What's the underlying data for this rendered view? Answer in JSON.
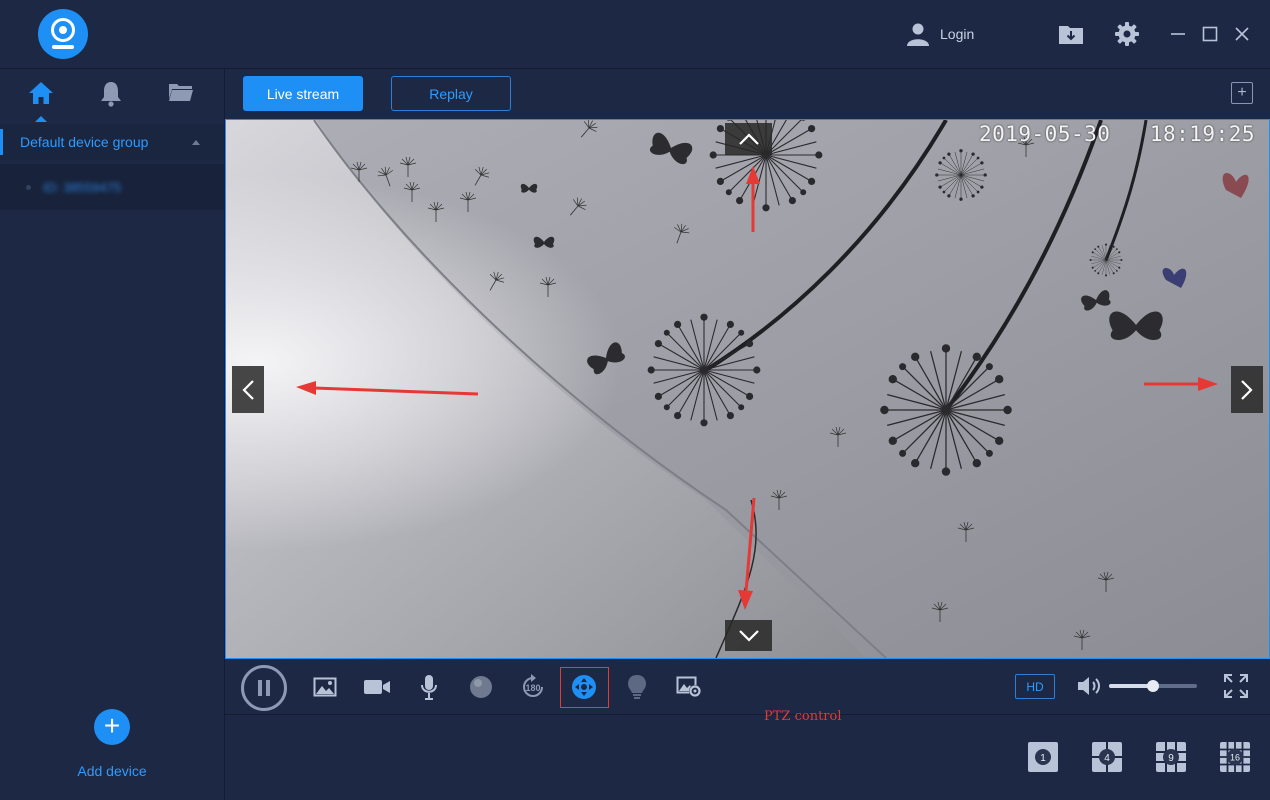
{
  "header": {
    "login_label": "Login"
  },
  "sidebar": {
    "tabs": [
      {
        "name": "home-icon",
        "active": true
      },
      {
        "name": "bell-icon",
        "active": false
      },
      {
        "name": "folder-icon",
        "active": false
      }
    ],
    "group_label": "Default device group",
    "device_label": "ID: 38559475",
    "add_device_label": "Add device"
  },
  "main": {
    "live_label": "Live stream",
    "replay_label": "Replay",
    "timestamp_date": "2019-05-30",
    "timestamp_time": "18:19:25",
    "ptz_caption": "PTZ control",
    "hd_label": "HD",
    "volume_level": 0.5,
    "layouts": [
      "1",
      "4",
      "9",
      "16"
    ]
  },
  "colors": {
    "accent": "#1e90f5",
    "background": "#1d2944",
    "annotation_red": "#e53935"
  },
  "icons": {
    "toolbar": [
      "pause-icon",
      "snapshot-icon",
      "record-icon",
      "microphone-icon",
      "sphere-icon",
      "rotate-180-icon",
      "ptz-control-icon",
      "light-bulb-icon",
      "settings-image-icon"
    ]
  }
}
